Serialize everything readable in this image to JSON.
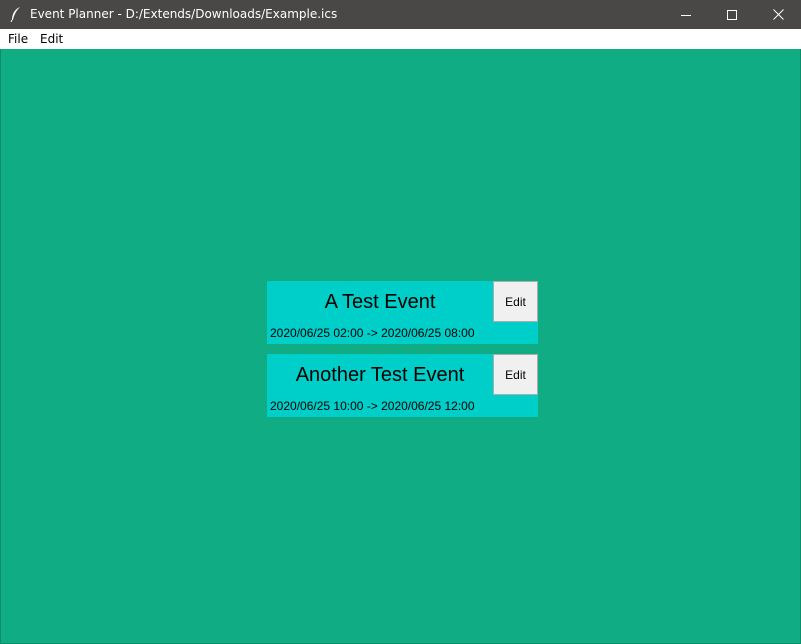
{
  "window": {
    "title": "Event Planner - D:/Extends/Downloads/Example.ics",
    "icon": "feather-icon",
    "controls": [
      "minimize-icon",
      "maximize-icon",
      "close-icon"
    ]
  },
  "menubar": {
    "items": [
      "File",
      "Edit"
    ]
  },
  "colors": {
    "background": "#10ac84",
    "card": "#00cec9",
    "titlebar": "#4a4846",
    "button": "#f0f0f0"
  },
  "events": [
    {
      "title": "A Test Event",
      "time": "2020/06/25 02:00 -> 2020/06/25 08:00",
      "edit_label": "Edit"
    },
    {
      "title": "Another Test Event",
      "time": "2020/06/25 10:00 -> 2020/06/25 12:00",
      "edit_label": "Edit"
    }
  ]
}
